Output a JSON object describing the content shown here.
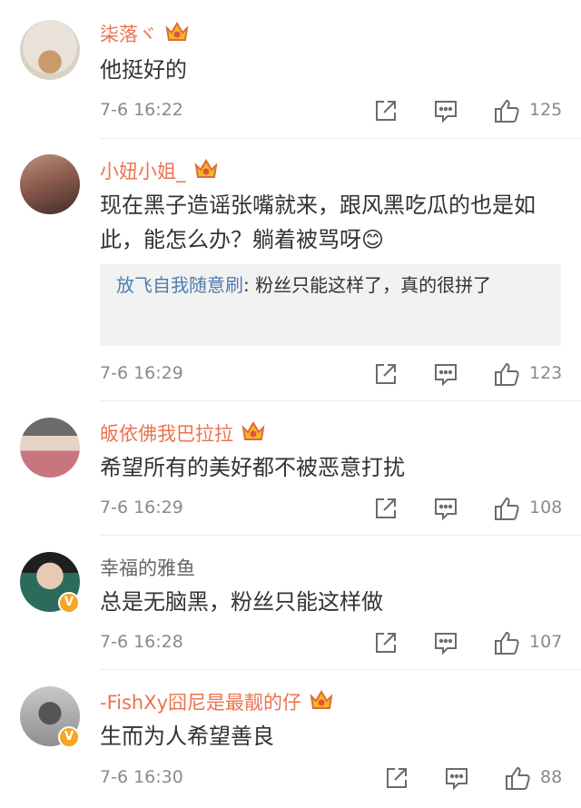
{
  "comments": [
    {
      "username": "柒落ヾ",
      "name_color": "vip",
      "has_crown": true,
      "verified": false,
      "text": "他挺好的",
      "time": "7-6 16:22",
      "likes": "125"
    },
    {
      "username": "小妞小姐_",
      "name_color": "vip",
      "has_crown": true,
      "verified": false,
      "text": "现在黑子造谣张嘴就来，跟风黑吃瓜的也是如此，能怎么办？躺着被骂呀😊",
      "reply": {
        "user": "放飞自我随意刷",
        "text": ": 粉丝只能这样了，真的很拼了"
      },
      "time": "7-6 16:29",
      "likes": "123"
    },
    {
      "username": "皈依佛我巴拉拉",
      "name_color": "vip",
      "has_crown": true,
      "verified": false,
      "text": "希望所有的美好都不被恶意打扰",
      "time": "7-6 16:29",
      "likes": "108"
    },
    {
      "username": "幸福的雅鱼",
      "name_color": "plain",
      "has_crown": false,
      "verified": true,
      "text": "总是无脑黑，粉丝只能这样做",
      "time": "7-6 16:28",
      "likes": "107"
    },
    {
      "username": "-FishXy囧尼是最靓的仔",
      "name_color": "vip",
      "has_crown": true,
      "verified": true,
      "text": "生而为人希望善良",
      "time": "7-6 16:30",
      "likes": "88"
    }
  ],
  "icons": {
    "share": "share-icon",
    "comment": "comment-icon",
    "like": "thumbs-up-icon",
    "vip": "crown-icon",
    "verified": "verified-v-icon"
  },
  "colors": {
    "vip_name": "#eb7350",
    "reply_user": "#507daf",
    "meta_gray": "#8a8a8a",
    "badge_orange": "#f5a623"
  }
}
